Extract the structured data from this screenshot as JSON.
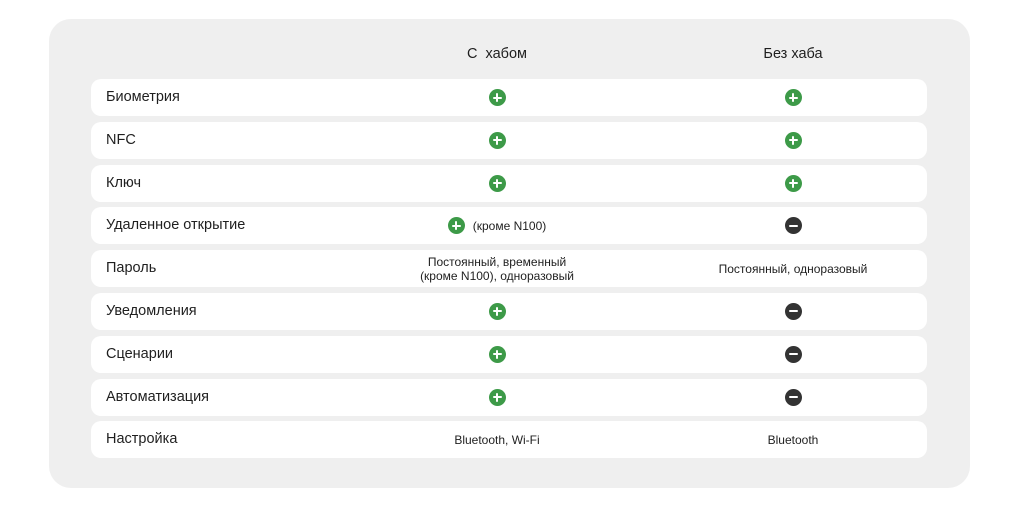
{
  "table": {
    "columns": [
      "С  хабом",
      "Без хаба"
    ],
    "rows": [
      {
        "label": "Биометрия",
        "with_hub": {
          "icon": "plus-circle-icon"
        },
        "without_hub": {
          "icon": "plus-circle-icon"
        }
      },
      {
        "label": "NFC",
        "with_hub": {
          "icon": "plus-circle-icon"
        },
        "without_hub": {
          "icon": "plus-circle-icon"
        }
      },
      {
        "label": "Ключ",
        "with_hub": {
          "icon": "plus-circle-icon"
        },
        "without_hub": {
          "icon": "plus-circle-icon"
        }
      },
      {
        "label": "Удаленное открытие",
        "with_hub": {
          "icon": "plus-circle-icon",
          "note": "(кроме N100)"
        },
        "without_hub": {
          "icon": "minus-circle-icon"
        }
      },
      {
        "label": "Пароль",
        "with_hub": {
          "text": "Постоянный, временный\n(кроме N100), одноразовый"
        },
        "without_hub": {
          "text": "Постоянный, одноразовый"
        }
      },
      {
        "label": "Уведомления",
        "with_hub": {
          "icon": "plus-circle-icon"
        },
        "without_hub": {
          "icon": "minus-circle-icon"
        }
      },
      {
        "label": "Сценарии",
        "with_hub": {
          "icon": "plus-circle-icon"
        },
        "without_hub": {
          "icon": "minus-circle-icon"
        }
      },
      {
        "label": "Автоматизация",
        "with_hub": {
          "icon": "plus-circle-icon"
        },
        "without_hub": {
          "icon": "minus-circle-icon"
        }
      },
      {
        "label": "Настройка",
        "with_hub": {
          "text": "Bluetooth, Wi-Fi"
        },
        "without_hub": {
          "text": "Bluetooth"
        }
      }
    ]
  },
  "colors": {
    "panel_bg": "#efefef",
    "row_bg": "#ffffff",
    "plus_icon": "#3d9a48",
    "minus_icon": "#333333",
    "text": "#1f1f1f"
  }
}
